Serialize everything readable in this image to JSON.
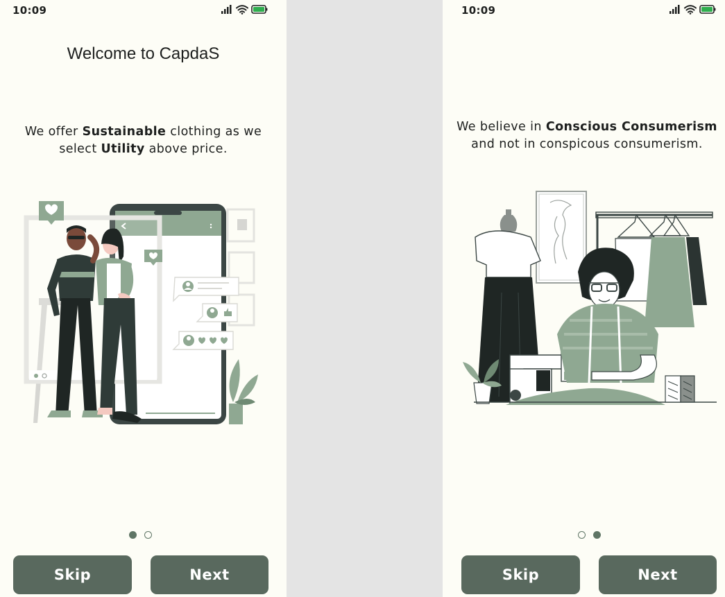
{
  "screens": [
    {
      "status": {
        "time": "10:09"
      },
      "title": "Welcome to CapdaS",
      "tagline": {
        "part1": "We offer ",
        "bold1": "Sustainable",
        "part2": " clothing as we select ",
        "bold2": "Utility",
        "part3": " above price."
      },
      "illustration": "couple-selfie-phone-illustration",
      "pager": {
        "active_index": 0,
        "total": 2
      },
      "buttons": {
        "skip": "Skip",
        "next": "Next"
      }
    },
    {
      "status": {
        "time": "10:09"
      },
      "tagline": {
        "part1": "We believe in ",
        "bold1": "Conscious Consumerism",
        "part2": " and not in conspicous consumerism."
      },
      "illustration": "tailor-sewing-illustration",
      "pager": {
        "active_index": 1,
        "total": 2
      },
      "buttons": {
        "skip": "Skip",
        "next": "Next"
      }
    }
  ],
  "colors": {
    "background": "#fdfdf6",
    "accent": "#59695e",
    "sage": "#8fa892",
    "dark": "#2b3432"
  },
  "icons": [
    "signal-icon",
    "wifi-icon",
    "battery-icon"
  ]
}
